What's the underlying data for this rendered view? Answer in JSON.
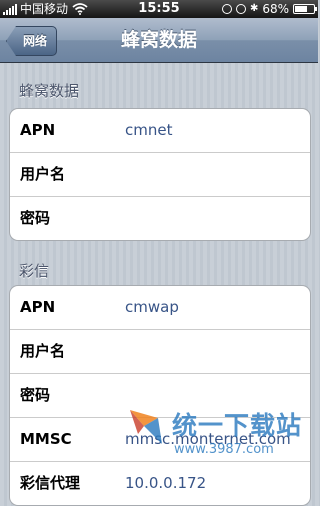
{
  "status_bar": {
    "carrier": "中国移动",
    "time": "15:55",
    "battery": "68%",
    "battery_level": 0.68
  },
  "nav": {
    "back_label": "网络",
    "title": "蜂窝数据"
  },
  "cellular_section": {
    "header": "蜂窝数据",
    "rows": [
      {
        "label": "APN",
        "value": "cmnet"
      },
      {
        "label": "用户名",
        "value": ""
      },
      {
        "label": "密码",
        "value": ""
      }
    ]
  },
  "mms_section": {
    "header": "彩信",
    "rows": [
      {
        "label": "APN",
        "value": "cmwap"
      },
      {
        "label": "用户名",
        "value": ""
      },
      {
        "label": "密码",
        "value": ""
      },
      {
        "label": "MMSC",
        "value": "mmsc.monternet.com"
      },
      {
        "label": "彩信代理",
        "value": "10.0.0.172"
      }
    ]
  },
  "watermark": {
    "brand": "统一下载站",
    "url": "www.3987.com"
  }
}
